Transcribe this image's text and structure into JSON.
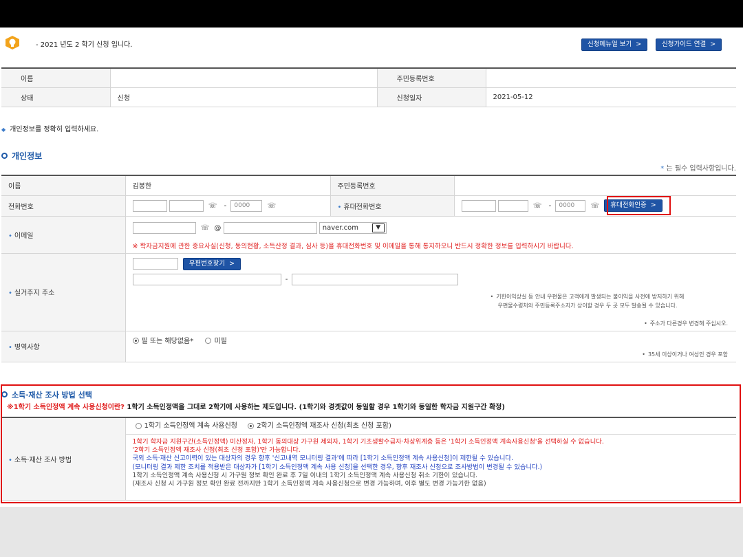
{
  "header": {
    "semester_notice": "- 2021 년도 2 학기 신청 입니다.",
    "manual_button": "신청메뉴얼 보기",
    "guide_button": "신청가이드 연결",
    "arrow": ">"
  },
  "summary": {
    "name_label": "이름",
    "name_value": "",
    "rrn_label": "주민등록번호",
    "rrn_value": "",
    "status_label": "상태",
    "status_value": "신청",
    "date_label": "신청일자",
    "date_value": "2021-05-12"
  },
  "notice": "개인정보를 정확히 입력하세요.",
  "personal": {
    "title": "개인정보",
    "required_note": "는 필수 입력사항입니다.",
    "required_star": "*",
    "name_label": "이름",
    "name_value": "김봉한",
    "rrn_label": "주민등록번호",
    "phone_label": "전화번호",
    "phone_placeholder": "0000",
    "mobile_label": "휴대전화번호",
    "mobile_placeholder": "0000",
    "mobile_verify_button": "휴대전화인증",
    "email_label": "이메일",
    "email_at": "@",
    "email_domain": "naver.com",
    "email_notice": "※ 학자금지원에 관한 중요사실(신청, 동의현황, 소득산정 결과, 심사 등)을 휴대전화번호 및 이메일을 통해 통지하오니 반드시 정확한 정보를 입력하시기 바랍니다.",
    "address_label": "실거주지 주소",
    "postcode_button": "우편번호찾기",
    "address_note_1": "기한이익상실 등 안내 우편물은 고객에게 발생되는 불이익을 사전에 방지하기 위해",
    "address_note_2": "우편물수령처와 주민등록주소지가 상이할 경우 두 곳 모두 발송될 수 있습니다.",
    "address_note_3": "주소가 다른경우 변경해 주십시오.",
    "military_label": "병역사항",
    "military_option_1": "필 또는 해당없음*",
    "military_option_2": "미필",
    "military_note": "35세 이상이거나 여성인 경우 포함",
    "dash": "-"
  },
  "income": {
    "title": "소득·재산 조사 방법 선택",
    "note_prefix": "※1학기 소득인정액 계속 사용신청이란?",
    "note_rest": " 1학기 소득인정액을 그대로 2학기에 사용하는 제도입니다. (1학기와 경곗값이 동일할 경우 1학기와 동일한 학자금 지원구간 확정)",
    "label": "소득·재산 조사 방법",
    "option_1": "1학기 소득인정액 계속 사용신청",
    "option_2": "2학기 소득인정액 재조사 신청(최초 신청 포함)",
    "line_1": "1학기 학자금 지원구간(소득인정액) 미산정자, 1학기 동의대상 가구원 제외자, 1학기 기초생활수급자·차상위계층 등은 '1학기 소득인정액 계속사용신청'을 선택하실 수 없습니다.",
    "line_2": "'2학기 소득인정액 재조사 신청(최초 신청 포함)'만 가능합니다.",
    "line_3": "국외 소득·재산 신고이력이 있는 대상자의 경우 향후 '신고내역 모니터링 결과'에 따라 [1학기 소득인정액 계속 사용신청]이 제한될 수 있습니다.",
    "line_4": "(모니터링 결과 제한 조치를 적용받은 대상자가 [1학기 소득인정액 계속 사용 신청]을 선택한 경우, 향후 재조사 신청으로 조사방법이 변경될 수 있습니다.)",
    "line_5": "1학기 소득인정액 계속 사용신청 시 가구원 정보 확인 완료 후 7일 이내의 1학기 소득인정액 계속 사용신청 취소 기한이 있습니다.",
    "line_6": "(재조사 신청 시 가구원 정보 확인 완료 전까지만 1학기 소득인정액 계속 사용신청으로 변경 가능하며, 이후 별도 변경 가능기한 없음)"
  },
  "colors": {
    "accent_blue": "#1f54a5",
    "highlight_red": "#e01010"
  }
}
